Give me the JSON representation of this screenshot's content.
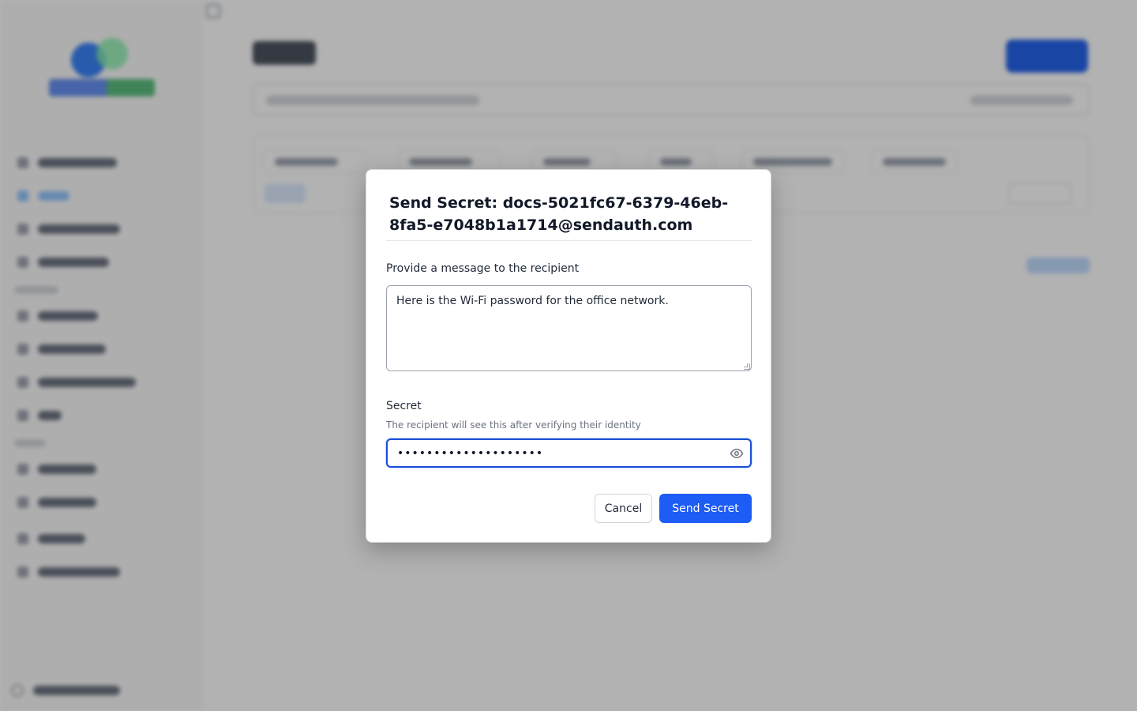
{
  "modal": {
    "title": "Send Secret: docs-5021fc67-6379-46eb-8fa5-e7048b1a1714@sendauth.com",
    "message_label": "Provide a message to the recipient",
    "message_value": "Here is the Wi-Fi password for the office network.",
    "secret_label": "Secret",
    "secret_help": "The recipient will see this after verifying their identity",
    "secret_masked_value": "••••••••••••••••••••",
    "secret_icon": "eye-icon",
    "cancel_label": "Cancel",
    "send_label": "Send Secret"
  },
  "colors": {
    "accent": "#1d5cf5",
    "focus_ring": "#1d4ed8",
    "overlay": "rgba(0,0,0,0.30)"
  }
}
